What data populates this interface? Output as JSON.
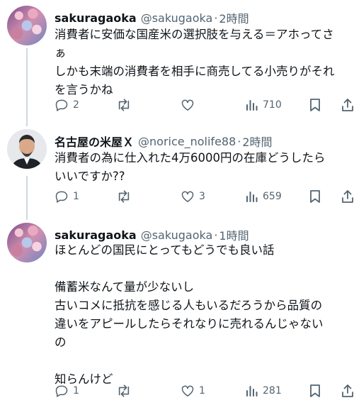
{
  "tweets": [
    {
      "name": "sakuragaoka",
      "handle": "@sakugaoka",
      "time": "2時間",
      "lines": [
        "消費者に安価な国産米の選択肢を与える＝アホってさ",
        "ぁ",
        "しかも末端の消費者を相手に商売してる小売りがそれ",
        "を言うかね"
      ],
      "replies": "2",
      "retweets": "",
      "likes": "",
      "views": "710"
    },
    {
      "name": "名古屋の米屋Ｘ",
      "handle": "@norice_nolife88",
      "time": "2時間",
      "lines": [
        "消費者の為に仕入れた4万6000円の在庫どうしたら",
        "いいですか??"
      ],
      "replies": "1",
      "retweets": "",
      "likes": "3",
      "views": "659"
    },
    {
      "name": "sakuragaoka",
      "handle": "@sakugaoka",
      "time": "1時間",
      "lines": [
        "ほとんどの国民にとってもどうでも良い話",
        "",
        "備蓄米なんて量が少ないし",
        "古いコメに抵抗を感じる人もいるだろうから品質の",
        "違いをアピールしたらそれなりに売れるんじゃない",
        "の",
        "",
        "知らんけど"
      ],
      "replies": "1",
      "retweets": "",
      "likes": "1",
      "views": "281"
    }
  ],
  "separator": "·",
  "icons": {
    "reply": "reply-icon",
    "retweet": "retweet-icon",
    "like": "heart-icon",
    "views": "views-chart-icon",
    "bookmark": "bookmark-icon",
    "share": "share-icon"
  },
  "colors": {
    "text": "#0f1419",
    "muted": "#536471",
    "line": "#cfd9de"
  }
}
